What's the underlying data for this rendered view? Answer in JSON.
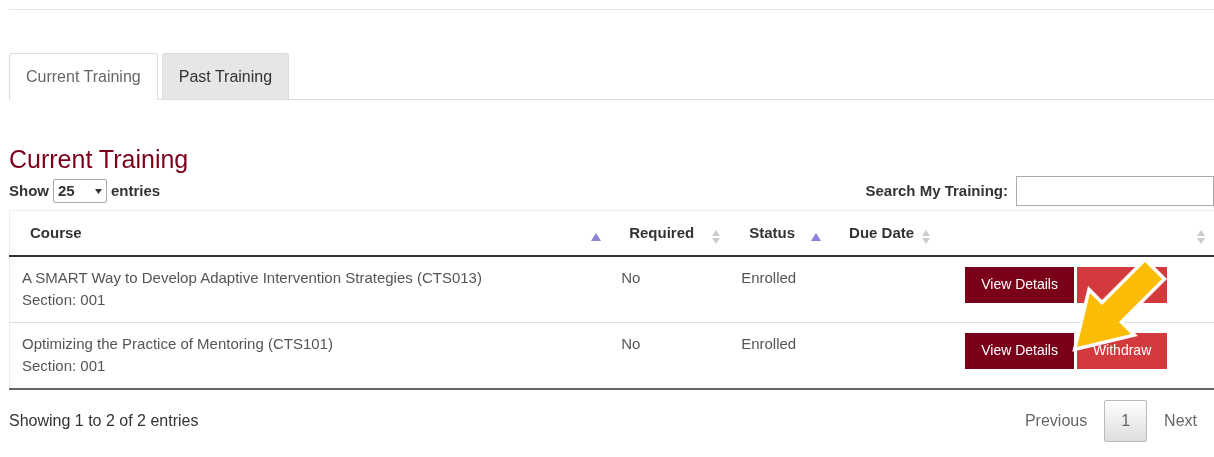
{
  "tabs": [
    {
      "label": "Current Training",
      "selected": true
    },
    {
      "label": "Past Training",
      "selected": false
    }
  ],
  "heading": "Current Training",
  "length_menu": {
    "before": "Show",
    "value": "25",
    "after": "entries"
  },
  "search": {
    "label": "Search My Training:"
  },
  "table": {
    "columns": [
      {
        "label": "Course",
        "sorted_ascending": true
      },
      {
        "label": "Required",
        "sorted_ascending": false
      },
      {
        "label": "Status",
        "sorted_ascending": true
      },
      {
        "label": "Due Date",
        "sorted_ascending": false
      },
      {
        "sorted_ascending": false
      }
    ],
    "rows": [
      {
        "course": "A SMART Way to Develop Adaptive Intervention Strategies (CTS013)",
        "section": "Section: 001",
        "required": "No",
        "status": "Enrolled",
        "buttons": [
          {
            "kind": "details",
            "label": "View Details"
          },
          {
            "kind": "withdraw"
          }
        ]
      },
      {
        "course": "Optimizing the Practice of Mentoring (CTS101)",
        "section": "Section: 001",
        "required": "No",
        "status": "Enrolled",
        "buttons": [
          {
            "kind": "details",
            "label": "View Details"
          },
          {
            "kind": "withdraw",
            "label": "Withdraw"
          }
        ]
      }
    ]
  },
  "info": "Showing 1 to 2 of 2 entries",
  "pagination": [
    {
      "label": "Previous",
      "selected": false
    },
    {
      "label": "1",
      "selected": true
    },
    {
      "label": "Next",
      "selected": false
    }
  ]
}
